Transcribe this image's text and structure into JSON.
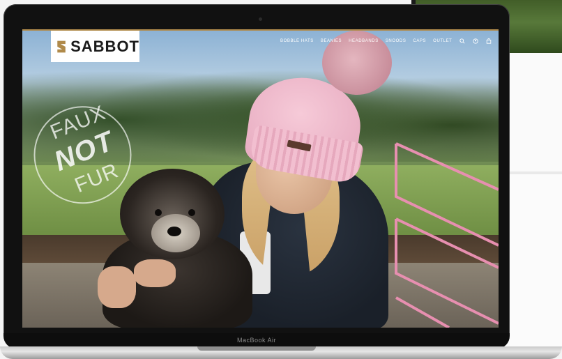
{
  "brand": {
    "name": "SABBOT",
    "accent": "#b08a4a"
  },
  "nav": {
    "items": [
      {
        "label": "BOBBLE HATS"
      },
      {
        "label": "BEANIES"
      },
      {
        "label": "HEADBANDS"
      },
      {
        "label": "SNOODS"
      },
      {
        "label": "CAPS"
      },
      {
        "label": "OUTLET"
      }
    ],
    "icons": [
      "search-icon",
      "account-icon",
      "bag-icon"
    ]
  },
  "hero": {
    "badge_line1": "FAUX",
    "badge_line2": "NOT",
    "badge_line3": "FUR",
    "chevron_color": "#e78fb0"
  },
  "device": {
    "label": "MacBook Air"
  }
}
